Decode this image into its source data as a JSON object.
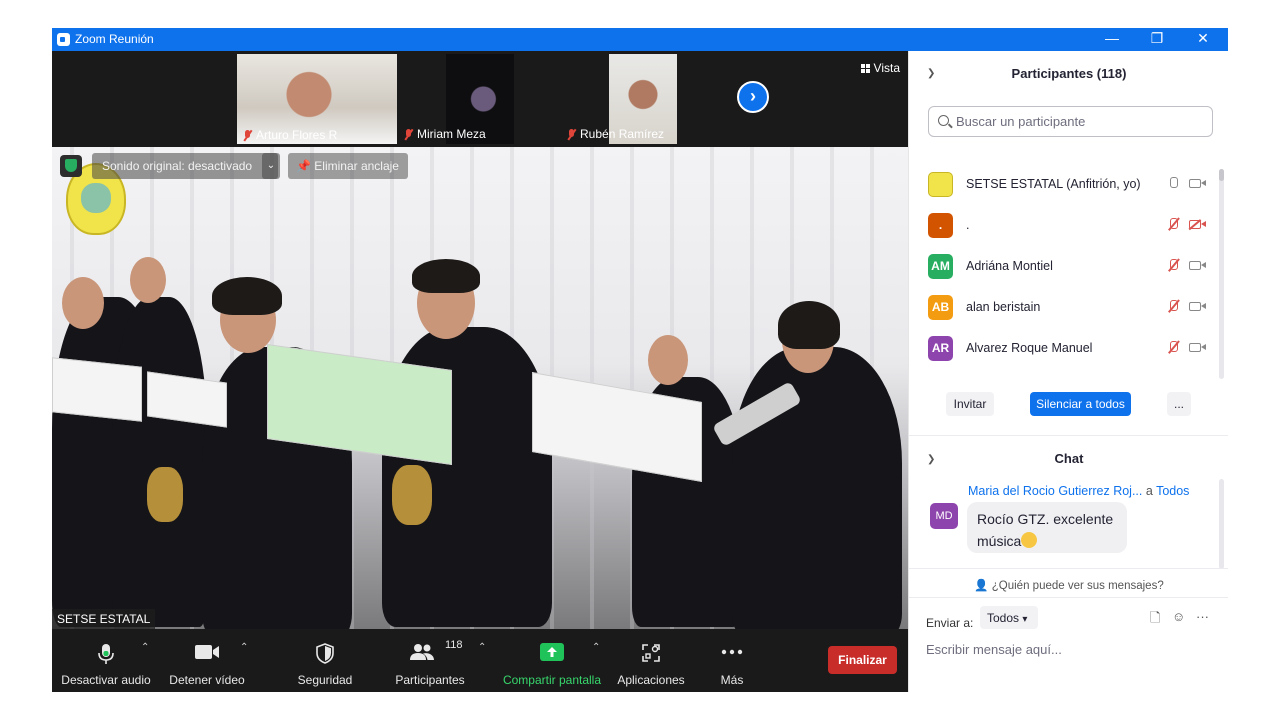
{
  "window": {
    "title": "Zoom Reunión",
    "minimize": "—",
    "restore": "❐",
    "close": "✕"
  },
  "thumbnails": [
    {
      "name": "Arturo Flores R"
    },
    {
      "name": "Miriam Meza"
    },
    {
      "name": "Rubén Ramírez"
    }
  ],
  "view_button": "Vista",
  "next_arrow": "›",
  "video_overlay": {
    "sound_original": "Sonido original: desactivado",
    "caret": "⌄",
    "unpin": "Eliminar anclaje",
    "speaker": "SETSE ESTATAL"
  },
  "toolbar": {
    "mute": "Desactivar audio",
    "stop_video": "Detener vídeo",
    "security": "Seguridad",
    "participants": "Participantes",
    "participants_count": "118",
    "share": "Compartir pantalla",
    "apps": "Aplicaciones",
    "more": "Más",
    "end": "Finalizar"
  },
  "participants_panel": {
    "title": "Participantes (118)",
    "search_placeholder": "Buscar un participante",
    "rows": [
      {
        "initials": "",
        "name": "SETSE ESTATAL (Anfitrión, yo)",
        "color": "#f1e44a",
        "mic": "on",
        "cam": "on"
      },
      {
        "initials": ".",
        "name": ".",
        "color": "#d35400",
        "mic": "off",
        "cam": "off"
      },
      {
        "initials": "AM",
        "name": "Adriána Montiel",
        "color": "#27ae60",
        "mic": "off",
        "cam": "on"
      },
      {
        "initials": "AB",
        "name": "alan beristain",
        "color": "#f39c12",
        "mic": "off",
        "cam": "on"
      },
      {
        "initials": "AR",
        "name": "Alvarez Roque Manuel",
        "color": "#8e44ad",
        "mic": "off",
        "cam": "on"
      }
    ],
    "invite": "Invitar",
    "mute_all": "Silenciar a todos",
    "more": "..."
  },
  "chat": {
    "title": "Chat",
    "sender": "Maria del Rocio Gutierrez Roj...",
    "to_prefix": "a",
    "to": "Todos",
    "avatar": "MD",
    "message": "Rocío GTZ. excelente música",
    "who_sees": "¿Quién puede ver sus mensajes?",
    "send_to_label": "Enviar a:",
    "send_to_value": "Todos",
    "input_placeholder": "Escribir mensaje aquí...",
    "more": "···"
  },
  "colors": {
    "accent": "#0e72ed",
    "end": "#c92d2a",
    "share": "#20c35a"
  }
}
